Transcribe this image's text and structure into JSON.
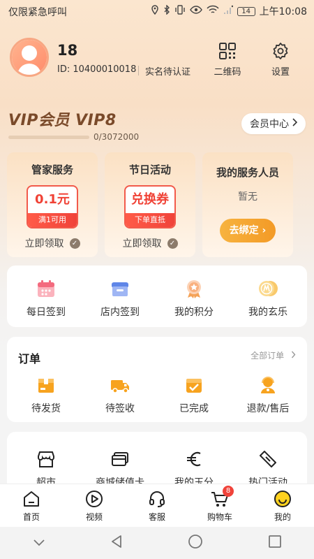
{
  "status_bar": {
    "carrier": "仅限紧急呼叫",
    "battery": "14",
    "time": "上午10:08"
  },
  "profile": {
    "username": "18",
    "user_id": "ID: 10400010018",
    "verify_status": "实名待认证",
    "qr_label": "二维码",
    "settings_label": "设置"
  },
  "vip": {
    "title": "VIP会员 VIP8",
    "progress_text": "0/3072000",
    "progress_fraction": 0,
    "member_center_label": "会员中心"
  },
  "cards": [
    {
      "title": "管家服务",
      "coupon_value": "0.1元",
      "coupon_note": "满1可用",
      "claim_label": "立即领取"
    },
    {
      "title": "节日活动",
      "coupon_value": "兑换券",
      "coupon_note": "下单直抵",
      "claim_label": "立即领取"
    },
    {
      "title": "我的服务人员",
      "status": "暂无",
      "bind_label": "去绑定"
    }
  ],
  "quick_actions": [
    {
      "label": "每日签到",
      "icon": "calendar-icon"
    },
    {
      "label": "店内签到",
      "icon": "store-checkin-icon"
    },
    {
      "label": "我的积分",
      "icon": "points-medal-icon"
    },
    {
      "label": "我的玄乐",
      "icon": "coin-icon"
    }
  ],
  "orders": {
    "title": "订单",
    "all_label": "全部订单",
    "items": [
      {
        "label": "待发货",
        "icon": "package-icon"
      },
      {
        "label": "待签收",
        "icon": "truck-icon"
      },
      {
        "label": "已完成",
        "icon": "completed-box-icon"
      },
      {
        "label": "退款/售后",
        "icon": "service-agent-icon"
      }
    ]
  },
  "services": [
    {
      "label": "超市",
      "icon": "shop-icon"
    },
    {
      "label": "商城储值卡",
      "icon": "card-icon"
    },
    {
      "label": "我的玉分",
      "icon": "euro-icon"
    },
    {
      "label": "热门活动",
      "icon": "ticket-icon"
    }
  ],
  "bottom_nav": [
    {
      "label": "首页",
      "icon": "home-icon"
    },
    {
      "label": "视频",
      "icon": "video-icon"
    },
    {
      "label": "客服",
      "icon": "headset-icon"
    },
    {
      "label": "购物车",
      "icon": "cart-icon",
      "badge": "8"
    },
    {
      "label": "我的",
      "icon": "smile-icon"
    }
  ],
  "colors": {
    "accent_red": "#f0433a",
    "accent_orange": "#f39a26",
    "vip_brown": "#7a4a2a",
    "yellow": "#ffd21f"
  }
}
